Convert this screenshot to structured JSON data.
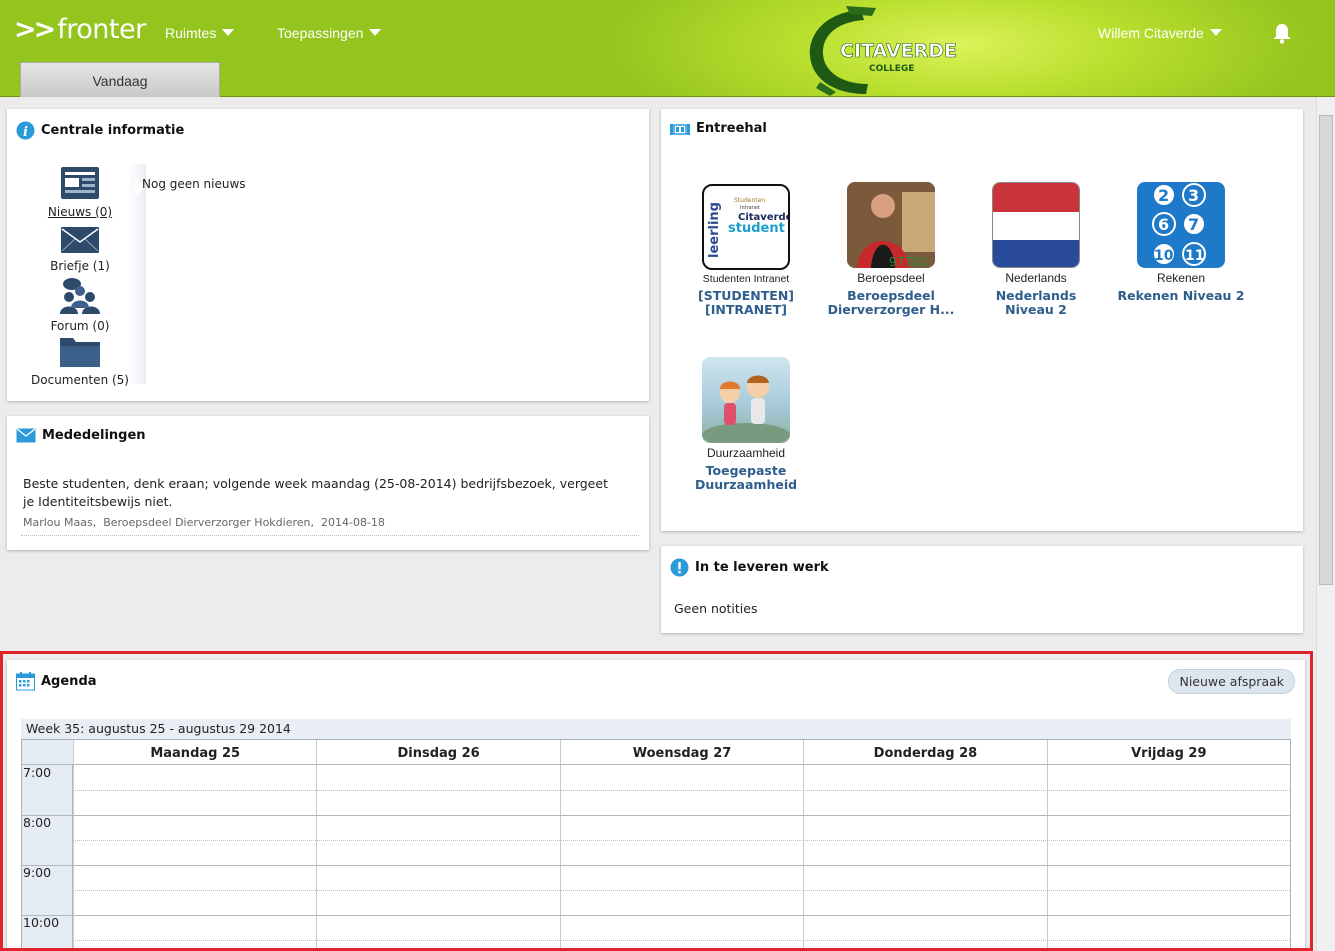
{
  "header": {
    "logo_arrows": ">>",
    "logo_text": "fronter",
    "nav": [
      "Ruimtes",
      "Toepassingen"
    ],
    "brand_line1": "CITAVERDE",
    "brand_line2": "COLLEGE",
    "user": "Willem Citaverde",
    "tab": "Vandaag"
  },
  "central": {
    "title": "Centrale informatie",
    "nav": [
      {
        "label": "Nieuws (0)",
        "icon": "newspaper-icon"
      },
      {
        "label": "Briefje (1)",
        "icon": "envelope-icon"
      },
      {
        "label": "Forum (0)",
        "icon": "forum-icon"
      },
      {
        "label": "Documenten (5)",
        "icon": "folder-icon"
      }
    ],
    "empty_text": "Nog geen nieuws"
  },
  "mededelingen": {
    "title": "Mededelingen",
    "message": "Beste studenten, denk eraan; volgende week maandag (25-08-2014) bedrijfsbezoek, vergeet je Identiteitsbewijs niet.",
    "meta": "Marlou Maas,  Beroepsdeel Dierverzorger Hokdieren,  2014-08-18"
  },
  "entreehal": {
    "title": "Entreehal",
    "tiles": [
      {
        "caption": "Studenten Intranet",
        "link": "[STUDENTEN] [INTRANET]",
        "img_words": [
          "Studenten",
          "Intranet",
          "leerling",
          "Citaverde",
          "student"
        ]
      },
      {
        "caption": "Beroepsdeel",
        "link": "Beroepsdeel Dierverzorger H...",
        "img_text": "97702"
      },
      {
        "caption": "Nederlands",
        "link": "Nederlands Niveau 2"
      },
      {
        "caption": "Rekenen",
        "link": "Rekenen Niveau 2",
        "numbers": [
          "2",
          "3",
          "6",
          "7",
          "10",
          "11"
        ]
      },
      {
        "caption": "Duurzaamheid",
        "link": "Toegepaste Duurzaamheid"
      }
    ]
  },
  "werk": {
    "title": "In te leveren werk",
    "text": "Geen notities"
  },
  "agenda": {
    "title": "Agenda",
    "new_button": "Nieuwe afspraak",
    "week": "Week 35: augustus 25 - augustus 29 2014",
    "days": [
      "Maandag 25",
      "Dinsdag 26",
      "Woensdag 27",
      "Donderdag 28",
      "Vrijdag 29"
    ],
    "hours": [
      "7:00",
      "8:00",
      "9:00",
      "10:00"
    ]
  },
  "colors": {
    "header_green": "#94c41e",
    "link_blue": "#2f5e8c",
    "highlight_red": "#e0242e"
  }
}
